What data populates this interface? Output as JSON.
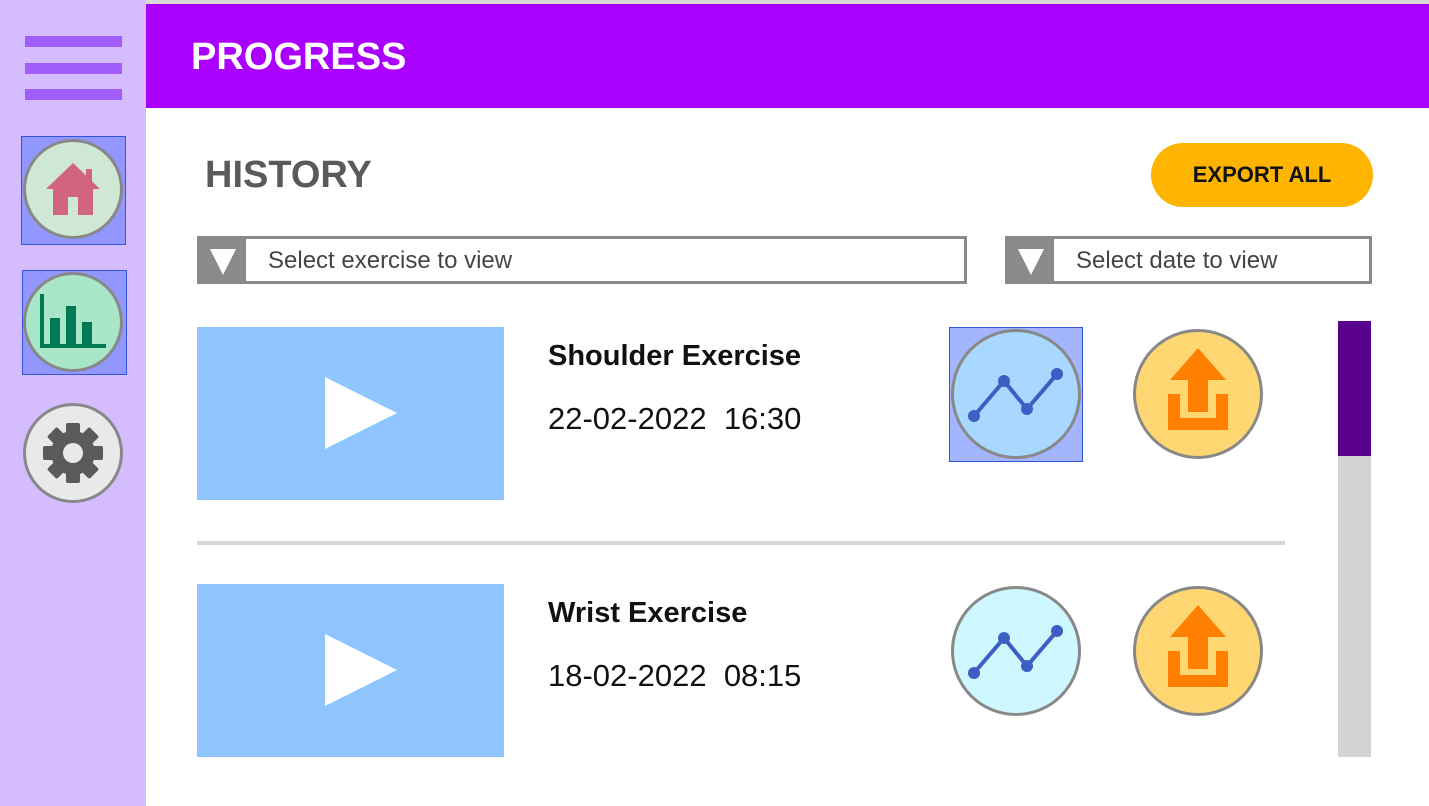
{
  "header": {
    "title": "PROGRESS"
  },
  "sidebar": {
    "menu_icon": "hamburger-menu-icon",
    "items": [
      {
        "name": "home",
        "icon": "home-icon",
        "color": "#d2647f",
        "selected": true
      },
      {
        "name": "stats",
        "icon": "bar-chart-icon",
        "color": "#007a55",
        "selected": true
      },
      {
        "name": "settings",
        "icon": "gear-icon",
        "color": "#5a5a5a",
        "selected": false
      }
    ]
  },
  "main": {
    "section_title": "HISTORY",
    "export_all_label": "EXPORT ALL",
    "filters": {
      "exercise_placeholder": "Select exercise to view",
      "date_placeholder": "Select date to view"
    },
    "records": [
      {
        "name": "Shoulder Exercise",
        "date": "22-02-2022",
        "time": "16:30",
        "chart_selected": true
      },
      {
        "name": "Wrist Exercise",
        "date": "18-02-2022",
        "time": "08:15",
        "chart_selected": false
      }
    ]
  },
  "colors": {
    "header_bg": "#a900ff",
    "sidebar_bg": "#d5bcff",
    "accent_button": "#ffb400",
    "video_thumb": "#90c4fc",
    "scroll_thumb": "#5a008f"
  }
}
